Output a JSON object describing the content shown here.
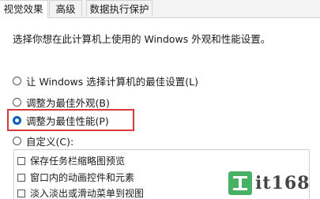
{
  "tabs": [
    {
      "label": "视觉效果",
      "active": true
    },
    {
      "label": "高级",
      "active": false
    },
    {
      "label": "数据执行保护",
      "active": false
    }
  ],
  "intro_text": "选择你想在此计算机上使用的 Windows 外观和性能设置。",
  "options": [
    {
      "label": "让 Windows 选择计算机的最佳设置(L)",
      "checked": false
    },
    {
      "label": "调整为最佳外观(B)",
      "checked": false
    },
    {
      "label": "调整为最佳性能(P)",
      "checked": true
    },
    {
      "label": "自定义(C):",
      "checked": false
    }
  ],
  "effects": [
    {
      "label": "保存任务栏缩略图预览",
      "checked": false
    },
    {
      "label": "窗口内的动画控件和元素",
      "checked": false
    },
    {
      "label": "淡入淡出或滑动菜单到视图",
      "checked": false
    }
  ],
  "highlight_color": "#d93a3a",
  "accent_color": "#005fb8",
  "watermark": {
    "logo_icon": "green-site-logo-icon",
    "text": "it168"
  }
}
